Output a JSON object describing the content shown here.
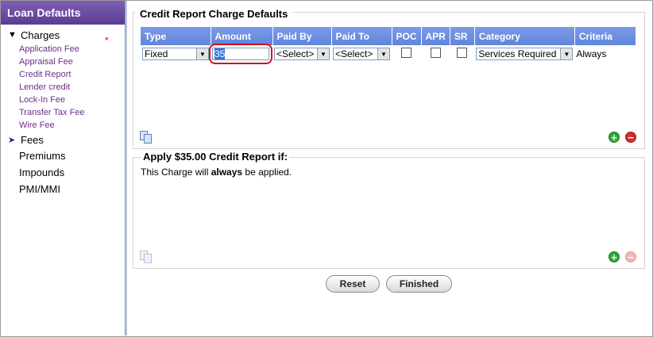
{
  "sidebar": {
    "title": "Loan Defaults",
    "charges_label": "Charges",
    "charges_arrow": "▼",
    "charge_items": [
      "Application Fee",
      "Appraisal Fee",
      "Credit Report",
      "Lender credit",
      "Lock-In Fee",
      "Transfer Tax Fee",
      "Wire Fee"
    ],
    "required_marker": "*",
    "fees_label": "Fees",
    "fees_arrow": "➤",
    "other_items": [
      "Premiums",
      "Impounds",
      "PMI/MMI"
    ]
  },
  "charge_defaults": {
    "legend": "Credit Report Charge Defaults",
    "columns": [
      "Type",
      "Amount",
      "Paid By",
      "Paid To",
      "POC",
      "APR",
      "SR",
      "Category",
      "Criteria"
    ],
    "row": {
      "type": "Fixed",
      "amount": "35",
      "paid_by": "<Select>",
      "paid_to": "<Select>",
      "poc": false,
      "apr": false,
      "sr": false,
      "category": "Services Required",
      "criteria": "Always"
    }
  },
  "apply": {
    "title": "Apply $35.00 Credit Report if:",
    "text_before": "This Charge will ",
    "text_bold": "always",
    "text_after": " be applied."
  },
  "buttons": {
    "reset": "Reset",
    "finished": "Finished"
  },
  "icons": {
    "add": "+",
    "remove": "−",
    "dropdown": "▼"
  }
}
